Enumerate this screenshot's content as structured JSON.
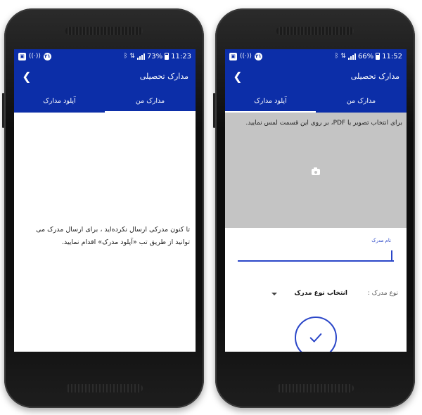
{
  "left_screen": {
    "status": {
      "battery": "73%",
      "time": "11:23"
    },
    "app_title": "مدارک تحصیلی",
    "tabs": [
      {
        "label": "مدارک من",
        "active": true
      },
      {
        "label": "آپلود مدارک",
        "active": false
      }
    ],
    "empty_message": "تا کنون مدرکی ارسال نکرده‌اید ، برای ارسال مدرک می توانید از طریق تب «آپلود مدرک» اقدام نمایید."
  },
  "right_screen": {
    "status": {
      "battery": "66%",
      "time": "11:52"
    },
    "app_title": "مدارک تحصیلی",
    "tabs": [
      {
        "label": "مدارک من",
        "active": false
      },
      {
        "label": "آپلود مدارک",
        "active": true
      }
    ],
    "upload_hint": "برای انتخاب تصویر یا PDF، بر روی این قسمت لمس نمایید.",
    "document_name_label": "نام مدرک",
    "document_name_value": "",
    "document_type_label": "نوع مدرک :",
    "document_type_select": "انتخاب نوع مدرک"
  },
  "colors": {
    "primary": "#0c2ea8",
    "accent": "#2a46c8",
    "upload_area": "#c4c4c4"
  },
  "icons": {
    "back": "chevron-left-icon",
    "camera": "camera-icon",
    "confirm": "check-icon",
    "dropdown": "caret-down-icon"
  }
}
